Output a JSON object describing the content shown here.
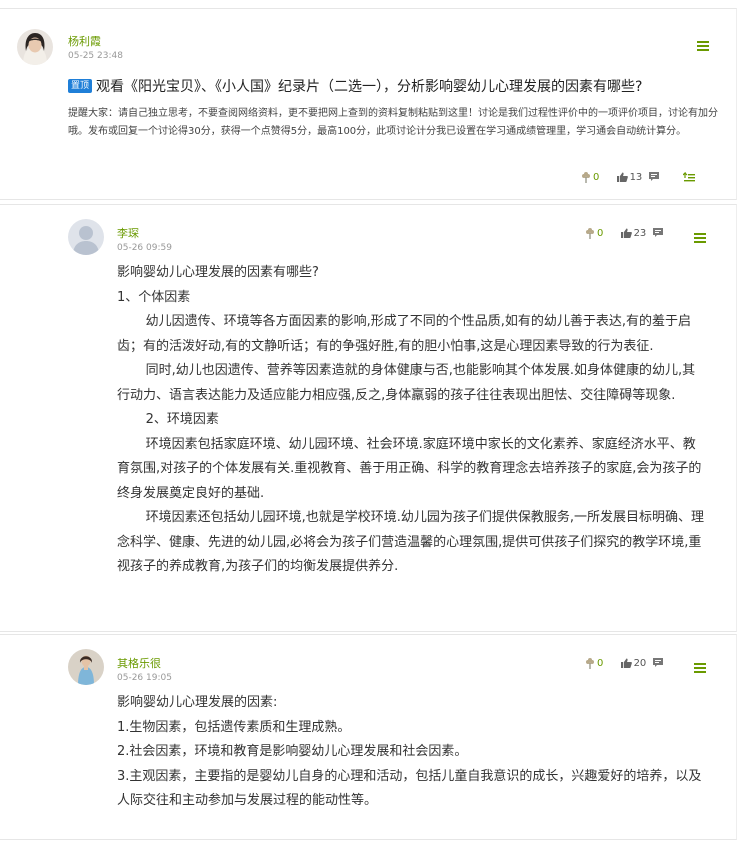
{
  "topic": {
    "author": "杨利霞",
    "timestamp": "05-25 23:48",
    "pin_label": "置顶",
    "title": "观看《阳光宝贝》、《小人国》纪录片（二选一），分析影响婴幼儿心理发展的因素有哪些?",
    "description": "提醒大家：请自己独立思考，不要查阅网络资料，更不要把网上查到的资料复制粘贴到这里！讨论是我们过程性评价中的一项评价项目，讨论有加分哦。发布或回复一个讨论得30分，获得一个点赞得5分，最高100分，此项讨论计分我已设置在学习通成绩管理里，学习通会自动统计算分。",
    "flowers": "0",
    "likes": "13"
  },
  "replies": [
    {
      "author": "李琛",
      "timestamp": "05-26 09:59",
      "flowers": "0",
      "likes": "23",
      "lines": [
        "影响婴幼儿心理发展的因素有哪些?",
        "1、个体因素",
        "幼儿因遗传、环境等各方面因素的影响,形成了不同的个性品质,如有的幼儿善于表达,有的羞于启齿；有的活泼好动,有的文静听话；有的争强好胜,有的胆小怕事,这是心理因素导致的行为表征.",
        "同时,幼儿也因遗传、营养等因素造就的身体健康与否,也能影响其个体发展.如身体健康的幼儿,其行动力、语言表达能力及适应能力相应强,反之,身体羸弱的孩子往往表现出胆怯、交往障碍等现象.",
        "2、环境因素",
        "环境因素包括家庭环境、幼儿园环境、社会环境.家庭环境中家长的文化素养、家庭经济水平、教育氛围,对孩子的个体发展有关.重视教育、善于用正确、科学的教育理念去培养孩子的家庭,会为孩子的终身发展奠定良好的基础.",
        "环境因素还包括幼儿园环境,也就是学校环境.幼儿园为孩子们提供保教服务,一所发展目标明确、理念科学、健康、先进的幼儿园,必将会为孩子们营造温馨的心理氛围,提供可供孩子们探究的教学环境,重视孩子的养成教育,为孩子们的均衡发展提供养分."
      ]
    },
    {
      "author": "其格乐很",
      "timestamp": "05-26 19:05",
      "flowers": "0",
      "likes": "20",
      "lines": [
        "影响婴幼儿心理发展的因素:",
        "1.生物因素，包括遗传素质和生理成熟。",
        "2.社会因素，环境和教育是影响婴幼儿心理发展和社会因素。",
        "3.主观因素，主要指的是婴幼儿自身的心理和活动，包括儿童自我意识的成长，兴趣爱好的培养，以及人际交往和主动参加与发展过程的能动性等。"
      ]
    }
  ],
  "colors": {
    "accent": "#6a9a00",
    "pin_badge": "#1f7fd8"
  },
  "icons": [
    "flower-icon",
    "thumbs-up-icon",
    "comment-icon",
    "menu-icon",
    "reply-icon"
  ]
}
